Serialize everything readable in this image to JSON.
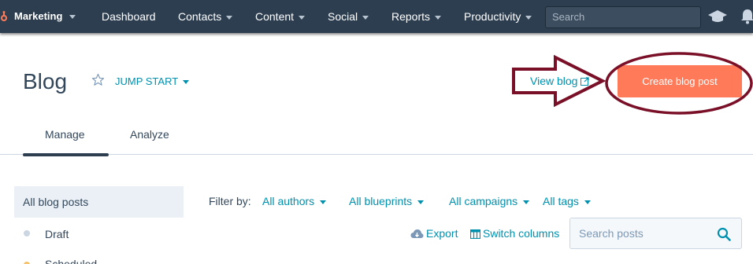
{
  "topnav": {
    "brand": "Marketing",
    "items": [
      {
        "label": "Dashboard",
        "has_caret": false
      },
      {
        "label": "Contacts",
        "has_caret": true
      },
      {
        "label": "Content",
        "has_caret": true
      },
      {
        "label": "Social",
        "has_caret": true
      },
      {
        "label": "Reports",
        "has_caret": true
      },
      {
        "label": "Productivity",
        "has_caret": true
      }
    ],
    "search_placeholder": "Search",
    "icons": [
      "hubspot-sprocket-icon",
      "graduation-cap-icon",
      "bell-icon"
    ]
  },
  "header": {
    "title": "Blog",
    "blog_selector": "JUMP START",
    "view_blog_label": "View blog",
    "create_button_label": "Create blog post"
  },
  "tabs": [
    {
      "label": "Manage",
      "active": true
    },
    {
      "label": "Analyze",
      "active": false
    }
  ],
  "sidebar": {
    "active_item": "All blog posts",
    "items": [
      {
        "label": "Draft",
        "dot_color": "#cbd6e2"
      },
      {
        "label": "Scheduled",
        "dot_color": "#f5c26b"
      }
    ]
  },
  "filters": {
    "label": "Filter by:",
    "options": [
      "All authors",
      "All blueprints",
      "All campaigns",
      "All tags"
    ]
  },
  "actions": {
    "export_label": "Export",
    "switch_columns_label": "Switch columns",
    "search_placeholder": "Search posts"
  },
  "colors": {
    "nav_bg": "#2d3e50",
    "link": "#0091ae",
    "primary_button": "#ff7a59",
    "text": "#33475b",
    "annotation": "#7a1028"
  }
}
